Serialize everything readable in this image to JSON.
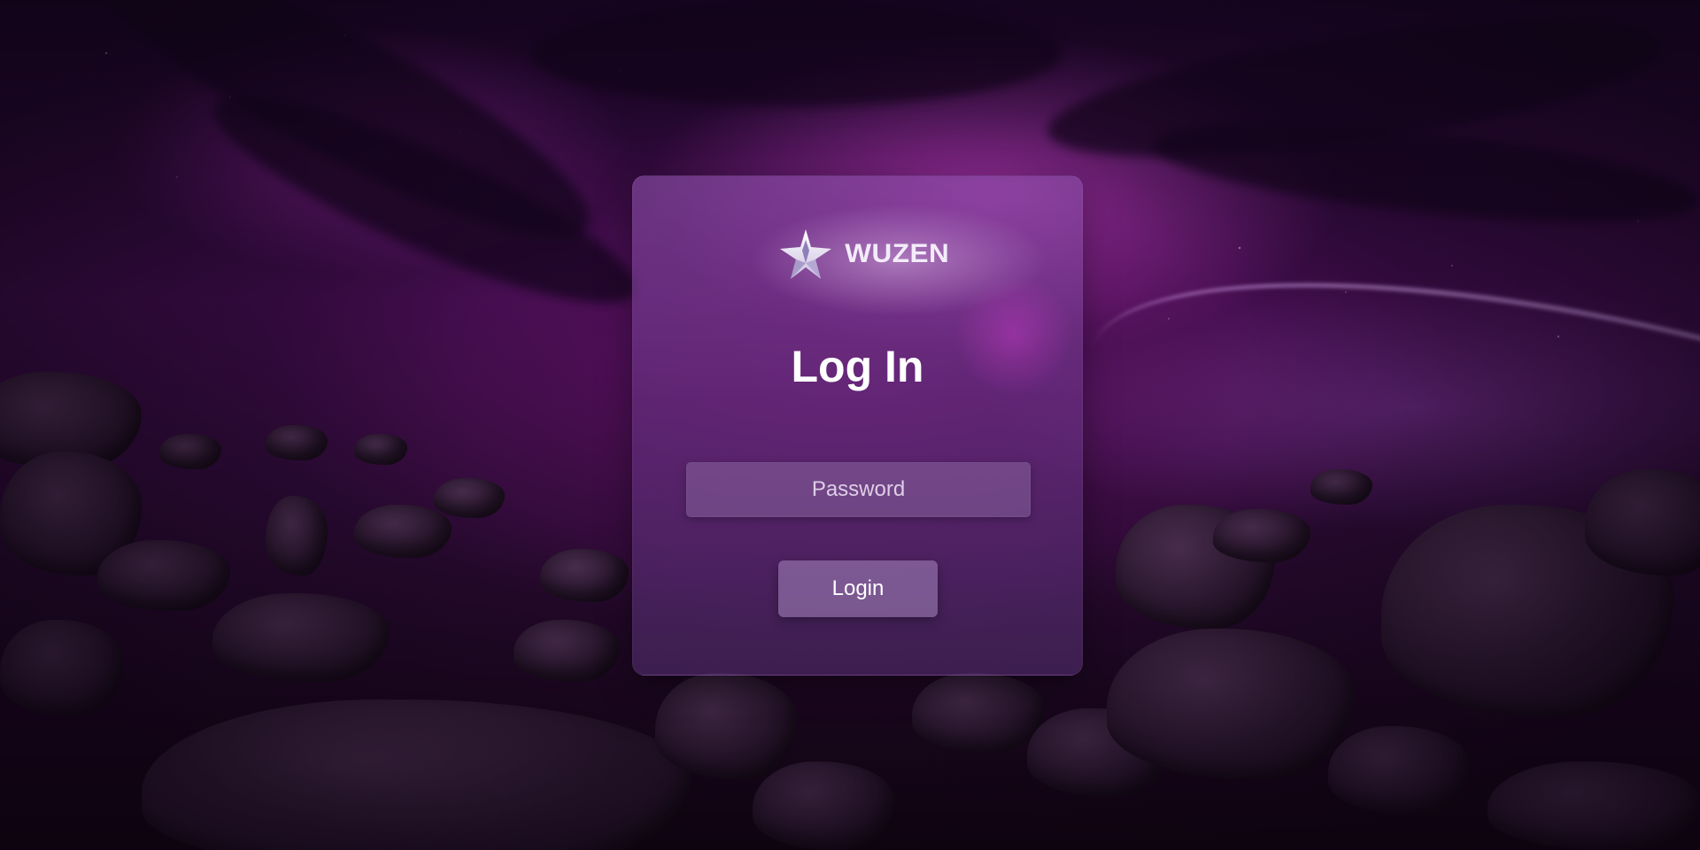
{
  "brand": {
    "name": "WUZEN",
    "icon": "star-logo-icon"
  },
  "login": {
    "title": "Log In",
    "password_placeholder": "Password",
    "password_value": "",
    "button_label": "Login"
  },
  "colors": {
    "background_accent": "#8a2a9a",
    "card_tint": "#7a4a9a",
    "text": "#ffffff"
  }
}
